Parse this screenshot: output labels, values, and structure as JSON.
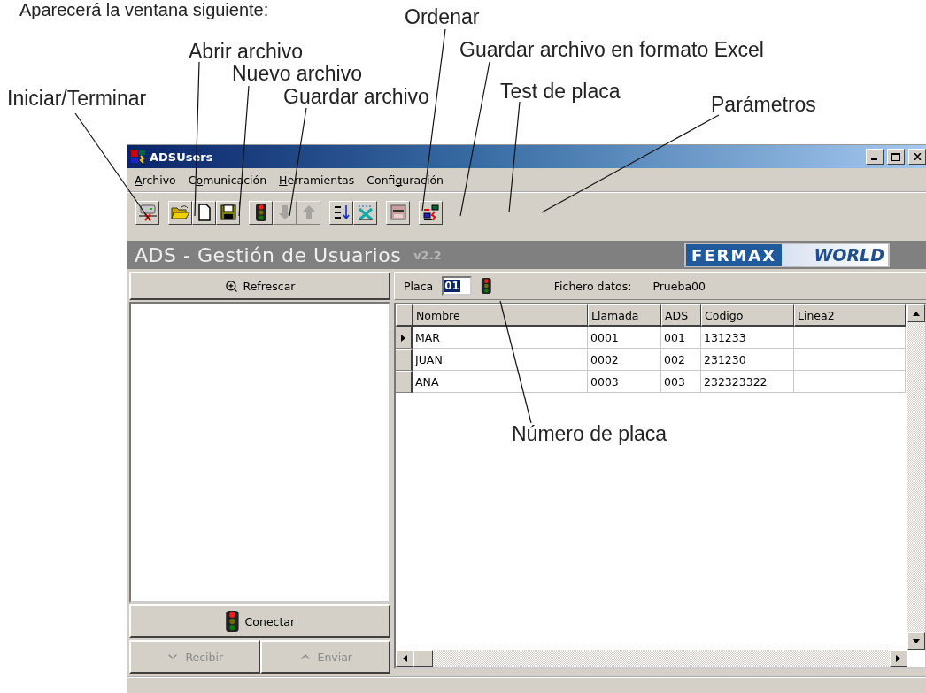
{
  "intro": "Aparecerá la ventana siguiente:",
  "callouts": [
    "Iniciar/Terminar",
    "Abrir archivo",
    "Nuevo archivo",
    "Guardar archivo",
    "Ordenar",
    "Guardar archivo en formato Excel",
    "Test de placa",
    "Parámetros",
    "Número de placa"
  ],
  "window": {
    "title": "ADSUsers"
  },
  "menu": [
    {
      "parts": [
        {
          "text": "A",
          "underlined": true
        },
        {
          "text": "rchivo",
          "underlined": false
        }
      ]
    },
    {
      "parts": [
        {
          "text": "C",
          "underlined": false
        },
        {
          "text": "o",
          "underlined": true
        },
        {
          "text": "municación",
          "underlined": false
        }
      ]
    },
    {
      "parts": [
        {
          "text": "H",
          "underlined": true
        },
        {
          "text": "erramientas",
          "underlined": false
        }
      ]
    },
    {
      "parts": [
        {
          "text": "Confi",
          "underlined": false
        },
        {
          "text": "g",
          "underlined": true
        },
        {
          "text": "uración",
          "underlined": false
        }
      ]
    }
  ],
  "toolbar": [
    [
      {
        "kind": "terminal",
        "disabled": false
      }
    ],
    [
      {
        "kind": "open",
        "disabled": false
      },
      {
        "kind": "new",
        "disabled": false
      },
      {
        "kind": "save",
        "disabled": false
      }
    ],
    [
      {
        "kind": "traffic",
        "disabled": false
      },
      {
        "kind": "down",
        "disabled": true
      },
      {
        "kind": "up",
        "disabled": true
      }
    ],
    [
      {
        "kind": "sort",
        "disabled": false
      },
      {
        "kind": "excel",
        "disabled": false
      }
    ],
    [
      {
        "kind": "device",
        "disabled": false
      }
    ],
    [
      {
        "kind": "params",
        "disabled": false
      }
    ]
  ],
  "header": {
    "title": "ADS - Gestión de Usuarios",
    "version": "v2.2",
    "logo_left": "FERMAX",
    "logo_right": "WORLD"
  },
  "left": {
    "refresh": "Refrescar",
    "connect": "Conectar",
    "receive": {
      "label": "Recibir",
      "disabled": true
    },
    "send": {
      "label": "Enviar",
      "disabled": true
    }
  },
  "placa": {
    "label": "Placa",
    "value": "01",
    "file_label": "Fichero datos:",
    "file_value": "Prueba00"
  },
  "table": {
    "columns": [
      "Nombre",
      "Llamada",
      "ADS",
      "Codigo",
      "Linea2"
    ],
    "rows": [
      {
        "selected": true,
        "cells": [
          "MAR",
          "0001",
          "001",
          "131233",
          ""
        ]
      },
      {
        "selected": false,
        "cells": [
          "JUAN",
          "0002",
          "002",
          "231230",
          ""
        ]
      },
      {
        "selected": false,
        "cells": [
          "ANA",
          "0003",
          "003",
          "232323322",
          ""
        ]
      }
    ]
  }
}
